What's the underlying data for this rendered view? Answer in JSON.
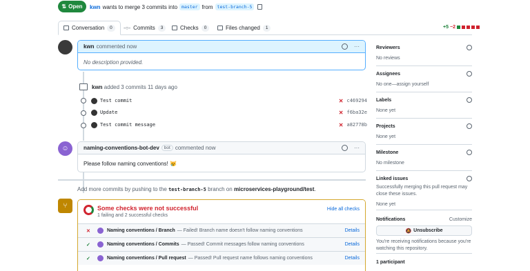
{
  "header": {
    "status": "Open",
    "author": "kwn",
    "merge_text": "wants to merge 3 commits into",
    "base_branch": "master",
    "from_text": "from",
    "head_branch": "test-branch-5"
  },
  "tabs": [
    {
      "label": "Conversation",
      "count": "0"
    },
    {
      "label": "Commits",
      "count": "3"
    },
    {
      "label": "Checks",
      "count": "0"
    },
    {
      "label": "Files changed",
      "count": "1"
    }
  ],
  "diffstat": {
    "additions": "+5",
    "deletions": "−2"
  },
  "first_comment": {
    "author": "kwn",
    "time": "commented now",
    "body": "No description provided."
  },
  "commits_event": {
    "author": "kwn",
    "text": "added 3 commits 11 days ago"
  },
  "commits": [
    {
      "message": "Test commit",
      "sha": "c469294"
    },
    {
      "message": "Update",
      "sha": "f6ba32e"
    },
    {
      "message": "Test commit message",
      "sha": "a82778b"
    }
  ],
  "bot_comment": {
    "author": "naming-conventions-bot-dev",
    "label": "bot",
    "time": "commented now",
    "body": "Please follow naming conventions! 😿"
  },
  "push_hint": {
    "prefix": "Add more commits by pushing to the",
    "branch": "test-branch-5",
    "middle": "branch on",
    "repo": "microservices-playground/test",
    "suffix": "."
  },
  "checks": {
    "title": "Some checks were not successful",
    "subtitle": "1 failing and 2 successful checks",
    "hide_label": "Hide all checks",
    "rows": [
      {
        "status": "fail",
        "name": "Naming conventions / Branch",
        "desc": "— Failed! Branch name doesn't follow naming conventions",
        "action": "Details"
      },
      {
        "status": "pass",
        "name": "Naming conventions / Commits",
        "desc": "— Passed! Commit messages follow naming conventions",
        "action": "Details"
      },
      {
        "status": "pass",
        "name": "Naming conventions / Pull request",
        "desc": "— Passed! Pull request name follows naming conventions",
        "action": "Details"
      }
    ]
  },
  "sidebar": {
    "reviewers": {
      "title": "Reviewers",
      "value": "No reviews"
    },
    "assignees": {
      "title": "Assignees",
      "value": "No one—assign yourself"
    },
    "labels": {
      "title": "Labels",
      "value": "None yet"
    },
    "projects": {
      "title": "Projects",
      "value": "None yet"
    },
    "milestone": {
      "title": "Milestone",
      "value": "No milestone"
    },
    "linked_issues": {
      "title": "Linked issues",
      "value": "Successfully merging this pull request may close these issues.",
      "value2": "None yet"
    },
    "notifications": {
      "title": "Notifications",
      "customize": "Customize",
      "button": "Unsubscribe",
      "note": "You're receiving notifications because you're watching this repository."
    },
    "participants": {
      "title": "1 participant"
    }
  },
  "colors": {
    "success": "#1f883d",
    "danger": "#d1242f",
    "accent": "#0969da",
    "warning_border": "#d4a72c"
  }
}
